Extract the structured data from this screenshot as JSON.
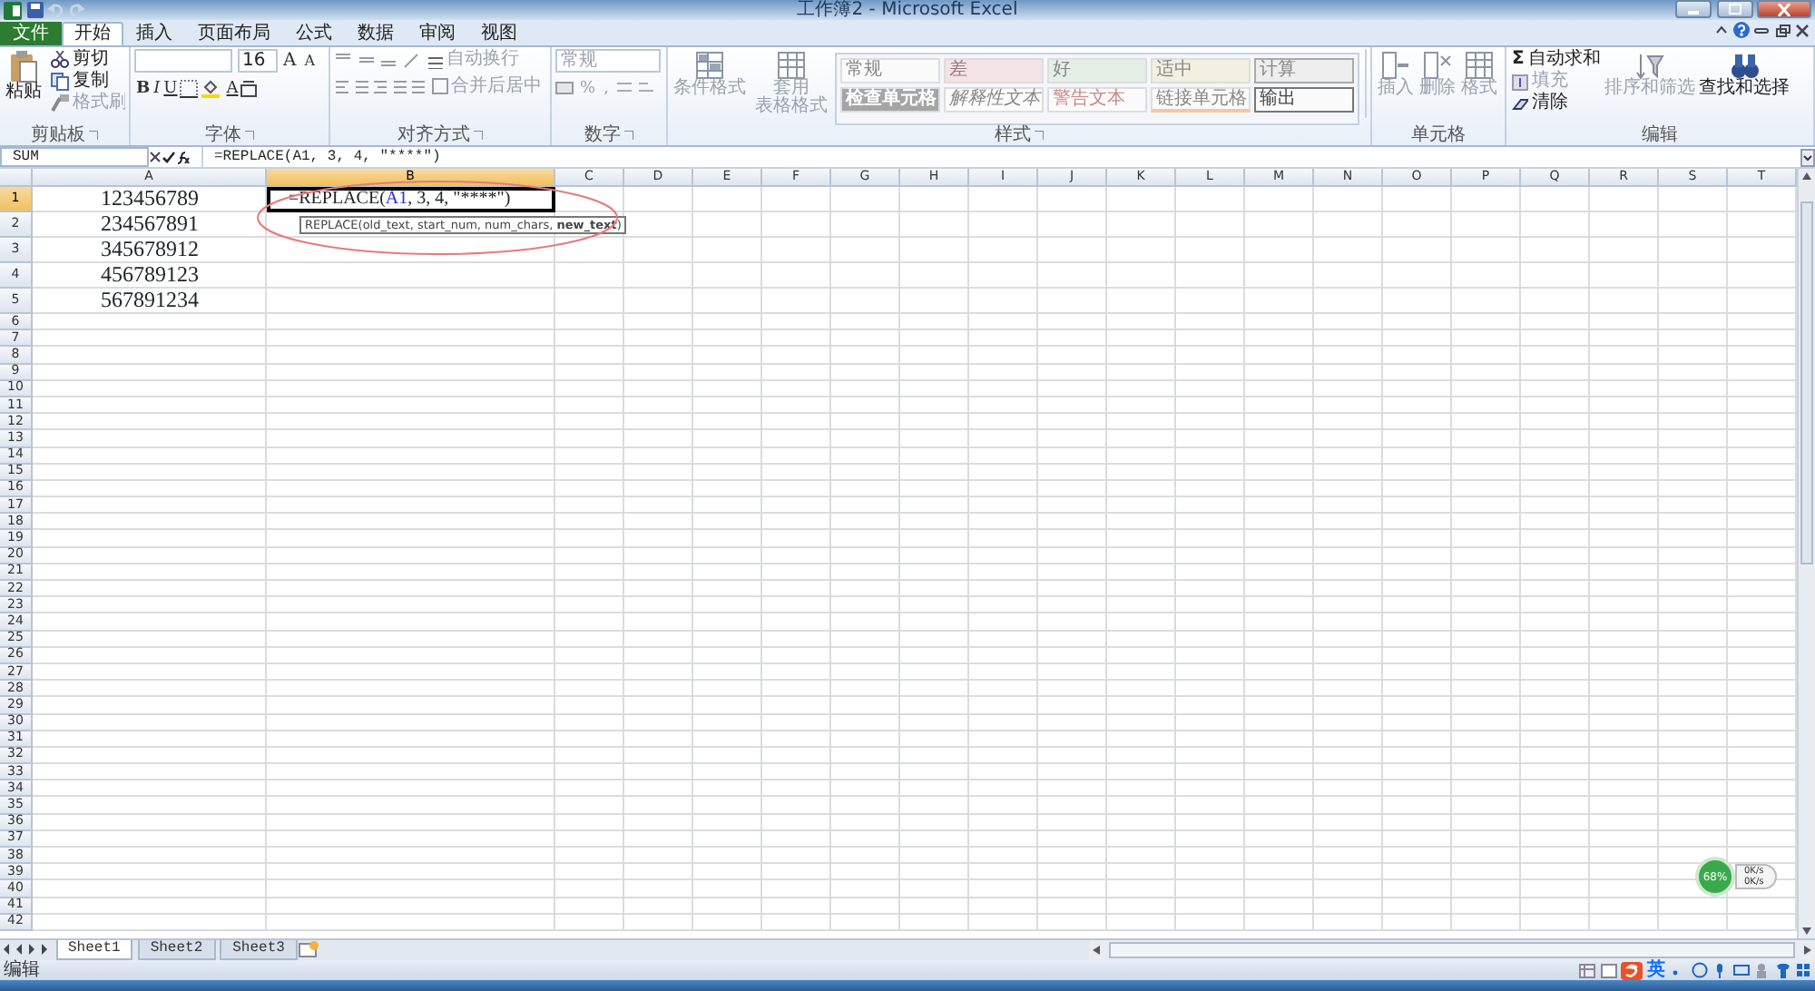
{
  "window": {
    "title": "工作簿2 - Microsoft Excel"
  },
  "tabs": [
    {
      "label": "文件",
      "kind": "file",
      "selected": false
    },
    {
      "label": "开始",
      "kind": "tab",
      "selected": true
    },
    {
      "label": "插入",
      "kind": "tab",
      "selected": false
    },
    {
      "label": "页面布局",
      "kind": "tab",
      "selected": false
    },
    {
      "label": "公式",
      "kind": "tab",
      "selected": false
    },
    {
      "label": "数据",
      "kind": "tab",
      "selected": false
    },
    {
      "label": "审阅",
      "kind": "tab",
      "selected": false
    },
    {
      "label": "视图",
      "kind": "tab",
      "selected": false
    }
  ],
  "ribbon": {
    "clipboard": {
      "label": "剪贴板",
      "paste": {
        "label": "粘贴",
        "disabled": false
      },
      "items": [
        {
          "label": "剪切",
          "disabled": false
        },
        {
          "label": "复制",
          "disabled": false
        },
        {
          "label": "格式刷",
          "disabled": true
        }
      ]
    },
    "font": {
      "label": "字体",
      "font_size": "16",
      "size_buttons": [
        "A",
        "A"
      ],
      "bold": "B",
      "italic": "I",
      "underline": "U",
      "font_color": "A"
    },
    "alignment": {
      "label": "对齐方式",
      "wrap": {
        "label": "自动换行",
        "disabled": true
      },
      "merge": {
        "label": "合并后居中",
        "disabled": true
      }
    },
    "number": {
      "label": "数字",
      "format": "常规",
      "percent": "%",
      "comma": ","
    },
    "styles": {
      "label": "样式",
      "buttons": [
        {
          "lines": [
            "条件格式"
          ],
          "disabled": true
        },
        {
          "lines": [
            "套用",
            "表格格式"
          ],
          "disabled": true
        }
      ],
      "gallery": [
        {
          "label": "常规",
          "kind": "normal"
        },
        {
          "label": "差",
          "kind": "bad"
        },
        {
          "label": "好",
          "kind": "good"
        },
        {
          "label": "适中",
          "kind": "neutral"
        },
        {
          "label": "计算",
          "kind": "calculation"
        },
        {
          "label": "检查单元格",
          "kind": "check"
        },
        {
          "label": "解释性文本",
          "kind": "explanatory"
        },
        {
          "label": "警告文本",
          "kind": "warning"
        },
        {
          "label": "链接单元格",
          "kind": "linked"
        },
        {
          "label": "输出",
          "kind": "output"
        }
      ]
    },
    "cells": {
      "label": "单元格",
      "buttons": [
        {
          "label": "插入",
          "kind": "insert",
          "disabled": true
        },
        {
          "label": "删除",
          "kind": "delete",
          "disabled": true
        },
        {
          "label": "格式",
          "kind": "format",
          "disabled": true
        }
      ]
    },
    "editing": {
      "label": "编辑",
      "items": [
        {
          "label": "自动求和",
          "kind": "sum",
          "symbol": "Σ",
          "disabled": false
        },
        {
          "label": "填充",
          "kind": "fill",
          "disabled": true
        },
        {
          "label": "清除",
          "kind": "clear",
          "disabled": false
        }
      ],
      "buttons": [
        {
          "label": "排序和筛选",
          "kind": "sort",
          "disabled": true
        },
        {
          "label": "查找和选择",
          "kind": "find",
          "disabled": false
        }
      ]
    }
  },
  "formula_bar": {
    "name_box": "SUM",
    "formula": "=REPLACE(A1, 3, 4, \"****\")"
  },
  "sheet": {
    "columns": [
      {
        "label": "A",
        "selected": false
      },
      {
        "label": "B",
        "selected": true
      },
      {
        "label": "C",
        "selected": false
      },
      {
        "label": "D",
        "selected": false
      },
      {
        "label": "E",
        "selected": false
      },
      {
        "label": "F",
        "selected": false
      },
      {
        "label": "G",
        "selected": false
      },
      {
        "label": "H",
        "selected": false
      },
      {
        "label": "I",
        "selected": false
      },
      {
        "label": "J",
        "selected": false
      },
      {
        "label": "K",
        "selected": false
      },
      {
        "label": "L",
        "selected": false
      },
      {
        "label": "M",
        "selected": false
      },
      {
        "label": "N",
        "selected": false
      },
      {
        "label": "O",
        "selected": false
      },
      {
        "label": "P",
        "selected": false
      },
      {
        "label": "Q",
        "selected": false
      },
      {
        "label": "R",
        "selected": false
      },
      {
        "label": "S",
        "selected": false
      },
      {
        "label": "T",
        "selected": false
      }
    ],
    "rows": [
      {
        "number": "1",
        "selected": true,
        "cells": {
          "A": "123456789"
        },
        "editing": [
          {
            "text": "=REPLACE(",
            "kind": "plain"
          },
          {
            "text": "A1",
            "kind": "reference"
          },
          {
            "text": ", 3, 4, \"****\")",
            "kind": "plain"
          }
        ]
      },
      {
        "number": "2",
        "selected": false,
        "cells": {
          "A": "234567891"
        }
      },
      {
        "number": "3",
        "selected": false,
        "cells": {
          "A": "345678912"
        }
      },
      {
        "number": "4",
        "selected": false,
        "cells": {
          "A": "456789123"
        }
      },
      {
        "number": "5",
        "selected": false,
        "cells": {
          "A": "567891234"
        }
      },
      {
        "number": "6",
        "selected": false
      },
      {
        "number": "7",
        "selected": false
      },
      {
        "number": "8",
        "selected": false
      },
      {
        "number": "9",
        "selected": false
      },
      {
        "number": "10",
        "selected": false
      },
      {
        "number": "11",
        "selected": false
      },
      {
        "number": "12",
        "selected": false
      },
      {
        "number": "13",
        "selected": false
      },
      {
        "number": "14",
        "selected": false
      },
      {
        "number": "15",
        "selected": false
      },
      {
        "number": "16",
        "selected": false
      },
      {
        "number": "17",
        "selected": false
      },
      {
        "number": "18",
        "selected": false
      },
      {
        "number": "19",
        "selected": false
      },
      {
        "number": "20",
        "selected": false
      },
      {
        "number": "21",
        "selected": false
      },
      {
        "number": "22",
        "selected": false
      },
      {
        "number": "23",
        "selected": false
      },
      {
        "number": "24",
        "selected": false
      },
      {
        "number": "25",
        "selected": false
      },
      {
        "number": "26",
        "selected": false
      },
      {
        "number": "27",
        "selected": false
      },
      {
        "number": "28",
        "selected": false
      },
      {
        "number": "29",
        "selected": false
      },
      {
        "number": "30",
        "selected": false
      },
      {
        "number": "31",
        "selected": false
      },
      {
        "number": "32",
        "selected": false
      },
      {
        "number": "33",
        "selected": false
      },
      {
        "number": "34",
        "selected": false
      },
      {
        "number": "35",
        "selected": false
      },
      {
        "number": "36",
        "selected": false
      },
      {
        "number": "37",
        "selected": false
      },
      {
        "number": "38",
        "selected": false
      },
      {
        "number": "39",
        "selected": false
      },
      {
        "number": "40",
        "selected": false
      },
      {
        "number": "41",
        "selected": false
      },
      {
        "number": "42",
        "selected": false
      }
    ],
    "tooltip": "REPLACE(old_text, start_num, num_chars, **new_text**)"
  },
  "sheet_tabs": [
    {
      "label": "Sheet1",
      "selected": true
    },
    {
      "label": "Sheet2",
      "selected": false
    },
    {
      "label": "Sheet3",
      "selected": false
    }
  ],
  "status_bar": {
    "mode": "编辑",
    "ime_mode": "英"
  },
  "speed_widget": {
    "percent": "68%",
    "rates": [
      "0K/s",
      "0K/s"
    ]
  }
}
